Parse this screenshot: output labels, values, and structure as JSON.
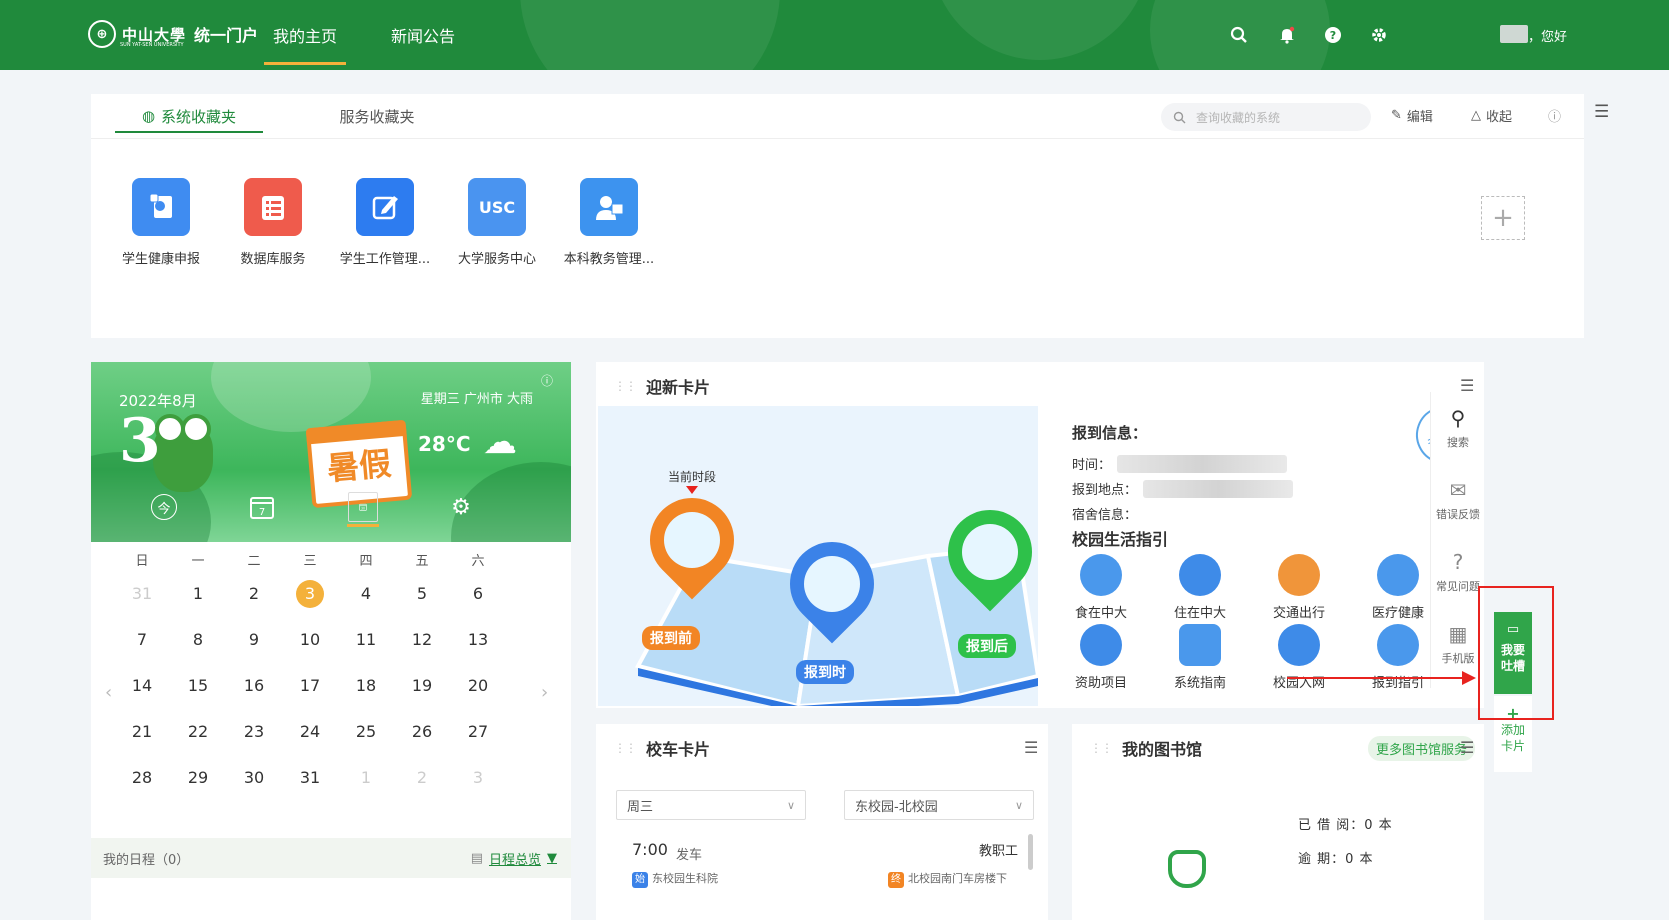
{
  "header": {
    "logo_cn": "中山大學",
    "logo_en": "SUN YAT-SEN UNIVERSITY",
    "portal": "统一门户",
    "nav": [
      "我的主页",
      "新闻公告"
    ],
    "greeting": "，您好",
    "icons": [
      "search-icon",
      "bell-icon",
      "help-icon",
      "gear-icon"
    ],
    "accent": "#208a3c"
  },
  "favorites": {
    "tabs": [
      "系统收藏夹",
      "服务收藏夹"
    ],
    "search_placeholder": "查询收藏的系统",
    "edit": "编辑",
    "collapse": "收起",
    "apps": [
      {
        "label": "学生健康申报",
        "color": "#3f8cf1"
      },
      {
        "label": "数据库服务",
        "color": "#ef5b4c"
      },
      {
        "label": "学生工作管理...",
        "color": "#2d7cf0"
      },
      {
        "label": "大学服务中心",
        "color": "#4a94f0",
        "text": "USC"
      },
      {
        "label": "本科教务管理...",
        "color": "#3d93ef"
      }
    ]
  },
  "calendar": {
    "year_month": "2022年8月",
    "day": "3",
    "weekday_city": "星期三  广州市  大雨",
    "temperature": "28°C",
    "vacation": "暑假",
    "today_label": "今",
    "cal_icon_a": "7",
    "cal_icon_b": "30",
    "weekdays": [
      "日",
      "一",
      "二",
      "三",
      "四",
      "五",
      "六"
    ],
    "weeks": [
      [
        "31",
        "1",
        "2",
        "3",
        "4",
        "5",
        "6"
      ],
      [
        "7",
        "8",
        "9",
        "10",
        "11",
        "12",
        "13"
      ],
      [
        "14",
        "15",
        "16",
        "17",
        "18",
        "19",
        "20"
      ],
      [
        "21",
        "22",
        "23",
        "24",
        "25",
        "26",
        "27"
      ],
      [
        "28",
        "29",
        "30",
        "31",
        "1",
        "2",
        "3"
      ]
    ],
    "schedule": "我的日程（0）",
    "overview": "日程总览"
  },
  "welcome_card": {
    "title": "迎新卡片",
    "current_stage": "当前时段",
    "before": "报到前",
    "during": "报到时",
    "after": "报到后",
    "info_title": "报到信息：",
    "time": "时间：",
    "place": "报到地点：",
    "dorm": "宿舍信息：",
    "stamp": "未报到",
    "guide_title": "校园生活指引",
    "guides": [
      [
        "食在中大",
        "住在中大",
        "交通出行",
        "医疗健康"
      ],
      [
        "资助项目",
        "系统指南",
        "校园入网",
        "报到指引"
      ]
    ]
  },
  "sidebar": {
    "search": "搜索",
    "feedback": "错误反馈",
    "faq": "常见问题",
    "mobile": "手机版",
    "complain_a": "我要",
    "complain_b": "吐槽",
    "add_a": "添加",
    "add_b": "卡片"
  },
  "bus_card": {
    "title": "校车卡片",
    "day": "周三",
    "route": "东校园-北校园",
    "time": "7:00",
    "depart": "发车",
    "type": "教职工",
    "start_tag": "始",
    "start": "东校园生科院",
    "end_tag": "终",
    "end": "北校园南门车房楼下"
  },
  "library_card": {
    "title": "我的图书馆",
    "more": "更多图书馆服务",
    "borrowed": "已 借 阅：0 本",
    "overdue": "逾    期：0 本"
  }
}
